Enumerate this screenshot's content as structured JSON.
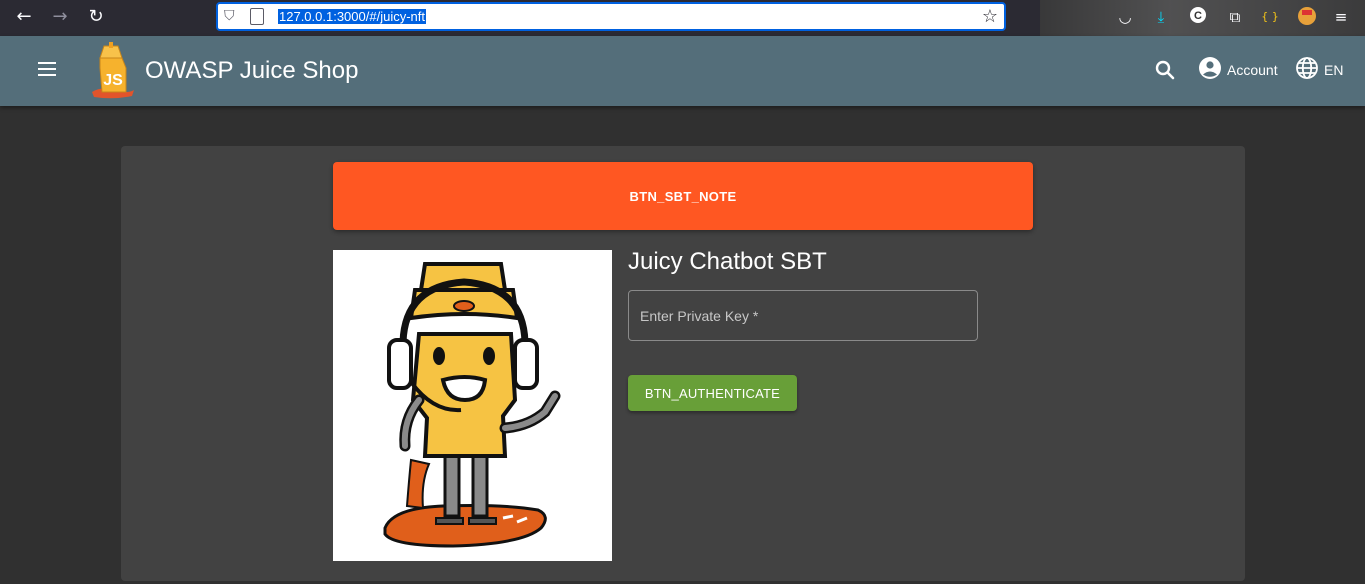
{
  "browser": {
    "url": "127.0.0.1:3000/#/juicy-nft",
    "icons": [
      "back-icon",
      "forward-icon",
      "reload-icon",
      "shield-icon",
      "page-icon",
      "bookmark-star-icon",
      "pocket-icon",
      "downloads-icon",
      "extension-icon",
      "puzzle-icon",
      "braces-icon",
      "avatar-icon",
      "menu-icon"
    ]
  },
  "toolbar": {
    "title": "OWASP Juice Shop",
    "account_label": "Account",
    "language_label": "EN",
    "color": "#546e7a"
  },
  "main": {
    "note_button": "BTN_SBT_NOTE",
    "nft_title": "Juicy Chatbot SBT",
    "private_key_placeholder": "Enter Private Key *",
    "authenticate_button": "BTN_AUTHENTICATE",
    "colors": {
      "note": "#ff5722",
      "authenticate": "#689f38",
      "card": "#424242",
      "background": "#303030"
    }
  }
}
